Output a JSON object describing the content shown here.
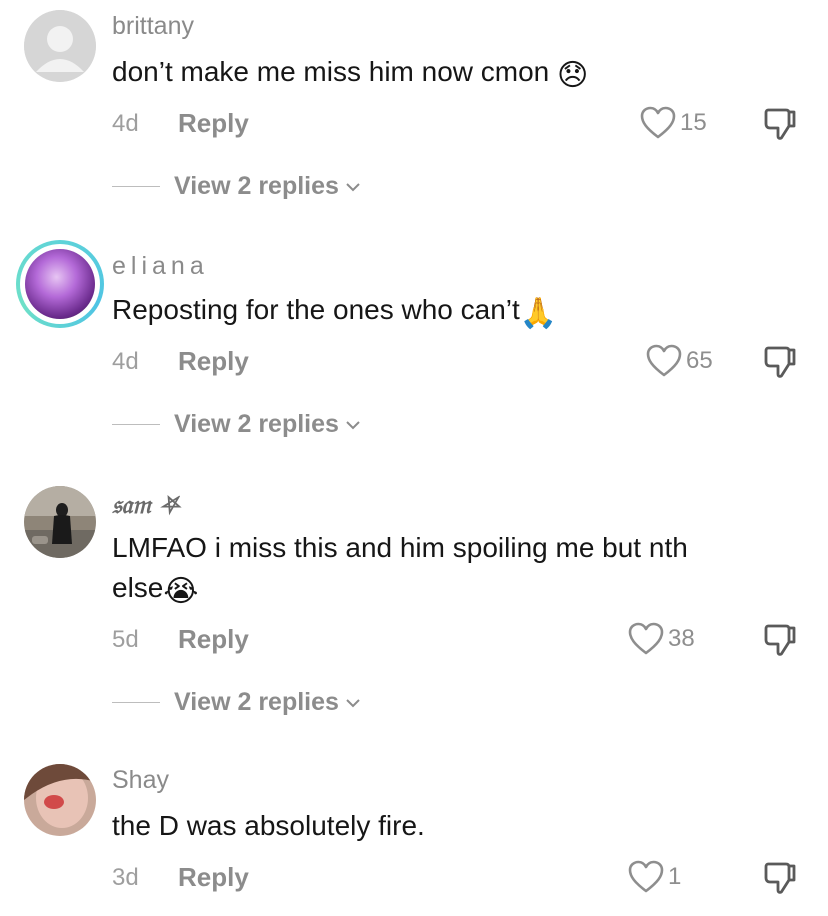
{
  "comments": [
    {
      "username": "brittany",
      "text": "don’t make me miss him now cmon",
      "emoji": "😞",
      "time": "4d",
      "reply_label": "Reply",
      "likes": "15",
      "view_replies": "View 2 replies"
    },
    {
      "username": "eliana",
      "text": "Reposting for the ones who can’t",
      "emoji": "🙏",
      "time": "4d",
      "reply_label": "Reply",
      "likes": "65",
      "view_replies": "View 2 replies"
    },
    {
      "username": "𝔰𝔞𝔪 ⛧",
      "text_line1": "LMFAO i miss this and him spoiling me but nth",
      "text_line2": "else",
      "emoji": "😭",
      "time": "5d",
      "reply_label": "Reply",
      "likes": "38",
      "view_replies": "View 2 replies"
    },
    {
      "username": "Shay",
      "text": "the D was absolutely fire.",
      "time": "3d",
      "reply_label": "Reply",
      "likes": "1"
    }
  ],
  "icons": {
    "like": "heart-outline-icon",
    "dislike": "thumbs-down-icon",
    "expand": "chevron-down-icon"
  },
  "colors": {
    "avatar_ring": "#5fd3d8",
    "secondary_text": "#8c8c8c"
  }
}
